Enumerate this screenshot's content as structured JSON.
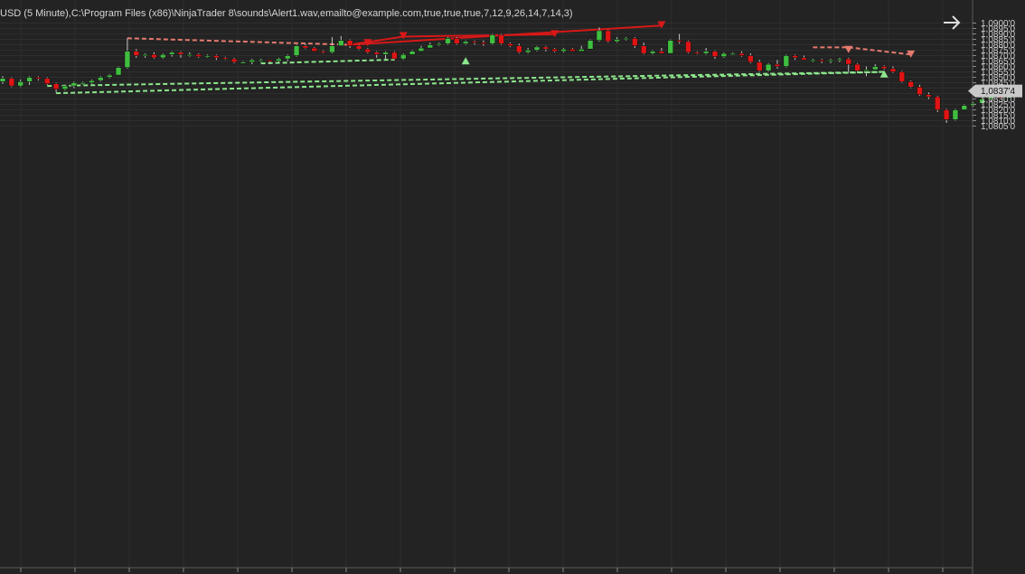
{
  "header": {
    "text": "USD (5 Minute),C:\\Program Files (x86)\\NinjaTrader 8\\sounds\\Alert1.wav,emailto@example.com,true,true,true,7,12,9,26,14,7,14,3)"
  },
  "colors": {
    "background": "#232323",
    "grid": "#2e2e2e",
    "up": "#3fbf3f",
    "down": "#e01414",
    "wick": "#c8c8c8",
    "bull_line": "#8ce68c",
    "bear_line_dashed": "#e57a6e",
    "bear_line_solid": "#d81818",
    "price_tag": "#c9c9c9"
  },
  "icons": {
    "nav": "arrow-right-icon"
  },
  "chart_data": {
    "type": "candlestick",
    "y_axis": {
      "range": [
        1.08015,
        1.0905
      ],
      "ticks": [
        "1,0900'0",
        "1,0895'0",
        "1,0890'0",
        "1,0885'0",
        "1,0880'0",
        "1,0875'0",
        "1,0870'0",
        "1,0865'0",
        "1,0860'0",
        "1,0855'0",
        "1,0850'0",
        "1,0845'0",
        "1,0840'0",
        "1,0835'0",
        "1,0830'0",
        "1,0825'0",
        "1,0820'0",
        "1,0815'0",
        "1,0810'0",
        "1,0805'0"
      ],
      "tick_values": [
        1.09,
        1.0895,
        1.089,
        1.0885,
        1.088,
        1.0875,
        1.087,
        1.0865,
        1.086,
        1.0855,
        1.085,
        1.0845,
        1.084,
        1.0835,
        1.083,
        1.0825,
        1.082,
        1.0815,
        1.081,
        1.0805
      ]
    },
    "current_price": {
      "label": "1,0837'4",
      "value": 1.08374
    },
    "candles": [
      [
        1.0846,
        1.0849,
        1.0844,
        1.0851
      ],
      [
        1.0849,
        1.0842,
        1.0841,
        1.085
      ],
      [
        1.0842,
        1.0846,
        1.0841,
        1.0848
      ],
      [
        1.0846,
        1.085,
        1.0843,
        1.0851
      ],
      [
        1.085,
        1.0849,
        1.0847,
        1.0851
      ],
      [
        1.0849,
        1.0844,
        1.0843,
        1.085
      ],
      [
        1.0844,
        1.0839,
        1.0836,
        1.0845
      ],
      [
        1.0839,
        1.0842,
        1.0838,
        1.0843
      ],
      [
        1.0842,
        1.0845,
        1.084,
        1.0846
      ],
      [
        1.0845,
        1.0845,
        1.0843,
        1.0846
      ],
      [
        1.0845,
        1.0847,
        1.0844,
        1.0848
      ],
      [
        1.0847,
        1.085,
        1.0846,
        1.0851
      ],
      [
        1.085,
        1.0852,
        1.0849,
        1.0853
      ],
      [
        1.0852,
        1.0859,
        1.0852,
        1.086
      ],
      [
        1.0859,
        1.0874,
        1.0858,
        1.0886
      ],
      [
        1.0874,
        1.087,
        1.0868,
        1.0876
      ],
      [
        1.087,
        1.0871,
        1.0868,
        1.0872
      ],
      [
        1.0871,
        1.0868,
        1.0867,
        1.0873
      ],
      [
        1.0868,
        1.0871,
        1.0867,
        1.0872
      ],
      [
        1.0871,
        1.0873,
        1.0869,
        1.0874
      ],
      [
        1.0873,
        1.0871,
        1.0868,
        1.0874
      ],
      [
        1.0871,
        1.0871,
        1.0869,
        1.0873
      ],
      [
        1.0871,
        1.0869,
        1.0868,
        1.0872
      ],
      [
        1.0869,
        1.087,
        1.0868,
        1.0871
      ],
      [
        1.087,
        1.0868,
        1.0866,
        1.0871
      ],
      [
        1.0868,
        1.0867,
        1.0866,
        1.0869
      ],
      [
        1.0867,
        1.0864,
        1.0863,
        1.0868
      ],
      [
        1.0864,
        1.0864,
        1.0863,
        1.0865
      ],
      [
        1.0864,
        1.0866,
        1.0862,
        1.0867
      ],
      [
        1.0866,
        1.0866,
        1.0864,
        1.0867
      ],
      [
        1.0866,
        1.0865,
        1.0863,
        1.0866
      ],
      [
        1.0865,
        1.0867,
        1.0864,
        1.0868
      ],
      [
        1.0867,
        1.087,
        1.0865,
        1.0871
      ],
      [
        1.087,
        1.0879,
        1.0869,
        1.088
      ],
      [
        1.0879,
        1.0877,
        1.0876,
        1.0881
      ],
      [
        1.0877,
        1.0874,
        1.0874,
        1.0878
      ],
      [
        1.0874,
        1.0873,
        1.0872,
        1.0875
      ],
      [
        1.0873,
        1.0879,
        1.0872,
        1.0887
      ],
      [
        1.0879,
        1.0884,
        1.0879,
        1.0888
      ],
      [
        1.0884,
        1.0879,
        1.0877,
        1.0885
      ],
      [
        1.0879,
        1.0876,
        1.0875,
        1.088
      ],
      [
        1.0876,
        1.0873,
        1.0872,
        1.0877
      ],
      [
        1.0873,
        1.0871,
        1.0868,
        1.0874
      ],
      [
        1.0871,
        1.0873,
        1.0867,
        1.0874
      ],
      [
        1.0873,
        1.0867,
        1.0866,
        1.0874
      ],
      [
        1.0867,
        1.0871,
        1.0866,
        1.0872
      ],
      [
        1.0871,
        1.0874,
        1.0871,
        1.0875
      ],
      [
        1.0874,
        1.0877,
        1.0874,
        1.0879
      ],
      [
        1.0877,
        1.088,
        1.0877,
        1.0882
      ],
      [
        1.088,
        1.0881,
        1.0879,
        1.0882
      ],
      [
        1.0881,
        1.0886,
        1.088,
        1.0887
      ],
      [
        1.0886,
        1.0881,
        1.088,
        1.0887
      ],
      [
        1.0881,
        1.0883,
        1.088,
        1.0884
      ],
      [
        1.0883,
        1.0882,
        1.088,
        1.0884
      ],
      [
        1.0882,
        1.0881,
        1.0879,
        1.0884
      ],
      [
        1.0881,
        1.0889,
        1.088,
        1.089
      ],
      [
        1.0889,
        1.0881,
        1.088,
        1.089
      ],
      [
        1.0881,
        1.0879,
        1.0878,
        1.0882
      ],
      [
        1.0879,
        1.0873,
        1.0872,
        1.0881
      ],
      [
        1.0873,
        1.0875,
        1.0872,
        1.0877
      ],
      [
        1.0875,
        1.0878,
        1.0874,
        1.0879
      ],
      [
        1.0878,
        1.0876,
        1.0874,
        1.0879
      ],
      [
        1.0876,
        1.0874,
        1.0873,
        1.0877
      ],
      [
        1.0874,
        1.0876,
        1.0873,
        1.0877
      ],
      [
        1.0876,
        1.0874,
        1.0874,
        1.0877
      ],
      [
        1.0874,
        1.0876,
        1.0874,
        1.0879
      ],
      [
        1.0876,
        1.0884,
        1.0876,
        1.0885
      ],
      [
        1.0884,
        1.0893,
        1.0883,
        1.0896
      ],
      [
        1.0893,
        1.0883,
        1.0882,
        1.0894
      ],
      [
        1.0883,
        1.0885,
        1.0882,
        1.0887
      ],
      [
        1.0885,
        1.0886,
        1.0884,
        1.0887
      ],
      [
        1.0886,
        1.0879,
        1.0877,
        1.0887
      ],
      [
        1.0879,
        1.0872,
        1.0871,
        1.0882
      ],
      [
        1.0872,
        1.0874,
        1.0871,
        1.0875
      ],
      [
        1.0874,
        1.0872,
        1.0872,
        1.0877
      ],
      [
        1.0872,
        1.0884,
        1.0872,
        1.0885
      ],
      [
        1.0884,
        1.0883,
        1.0881,
        1.089
      ],
      [
        1.0883,
        1.0873,
        1.0872,
        1.0884
      ],
      [
        1.0873,
        1.0872,
        1.0871,
        1.0874
      ],
      [
        1.0872,
        1.0874,
        1.0871,
        1.0877
      ],
      [
        1.0874,
        1.0869,
        1.0867,
        1.0875
      ],
      [
        1.0869,
        1.0872,
        1.0868,
        1.0873
      ],
      [
        1.0872,
        1.0872,
        1.0871,
        1.0873
      ],
      [
        1.0872,
        1.087,
        1.0869,
        1.0874
      ],
      [
        1.087,
        1.0864,
        1.0863,
        1.0872
      ],
      [
        1.0864,
        1.0856,
        1.0855,
        1.0866
      ],
      [
        1.0856,
        1.0862,
        1.0855,
        1.0863
      ],
      [
        1.0862,
        1.086,
        1.0858,
        1.0866
      ],
      [
        1.086,
        1.087,
        1.0859,
        1.0871
      ],
      [
        1.087,
        1.0868,
        1.0866,
        1.0871
      ],
      [
        1.0868,
        1.0866,
        1.0866,
        1.087
      ],
      [
        1.0866,
        1.0866,
        1.0864,
        1.0867
      ],
      [
        1.0866,
        1.0865,
        1.0863,
        1.0867
      ],
      [
        1.0865,
        1.0866,
        1.0863,
        1.0867
      ],
      [
        1.0866,
        1.0867,
        1.0864,
        1.0868
      ],
      [
        1.0867,
        1.0862,
        1.0855,
        1.0868
      ],
      [
        1.0862,
        1.0856,
        1.0855,
        1.0863
      ],
      [
        1.0856,
        1.0857,
        1.0851,
        1.086
      ],
      [
        1.0857,
        1.086,
        1.0857,
        1.0862
      ],
      [
        1.086,
        1.0858,
        1.0857,
        1.0861
      ],
      [
        1.0858,
        1.0855,
        1.0854,
        1.086
      ],
      [
        1.0855,
        1.0846,
        1.0845,
        1.0856
      ],
      [
        1.0846,
        1.0841,
        1.084,
        1.0847
      ],
      [
        1.0841,
        1.0834,
        1.0833,
        1.0843
      ],
      [
        1.0834,
        1.0832,
        1.083,
        1.0836
      ],
      [
        1.0832,
        1.082,
        1.0818,
        1.0833
      ],
      [
        1.082,
        1.0811,
        1.0808,
        1.0821
      ],
      [
        1.0811,
        1.082,
        1.081,
        1.0821
      ],
      [
        1.082,
        1.0824,
        1.082,
        1.0825
      ],
      [
        1.0824,
        1.0826,
        1.0823,
        1.0827
      ],
      [
        1.0826,
        1.083,
        1.0825,
        1.0831
      ],
      [
        1.083,
        1.0833,
        1.0828,
        1.0834
      ],
      [
        1.0833,
        1.0831,
        1.083,
        1.0834
      ],
      [
        1.0831,
        1.0838,
        1.0831,
        1.0839
      ]
    ],
    "bull_trendlines": [
      {
        "from": [
          5,
          1.0842
        ],
        "to": [
          99,
          1.0855
        ]
      },
      {
        "from": [
          6,
          1.08353
        ],
        "to": [
          99,
          1.0855
        ]
      },
      {
        "from": [
          29,
          1.08628
        ],
        "to": [
          44,
          1.08663
        ]
      }
    ],
    "bear_trendlines_dashed": [
      {
        "from": [
          14,
          1.0886
        ],
        "to": [
          39,
          1.088
        ]
      },
      {
        "from": [
          91,
          1.08776
        ],
        "to": [
          95,
          1.08776
        ]
      },
      {
        "from": [
          95,
          1.08776
        ],
        "to": [
          102,
          1.0871
        ]
      }
    ],
    "bear_trendlines_solid": [
      {
        "from": [
          39,
          1.088
        ],
        "to": [
          45,
          1.08875
        ]
      },
      {
        "from": [
          45,
          1.08875
        ],
        "to": [
          62,
          1.08896
        ]
      },
      {
        "from": [
          39,
          1.088
        ],
        "to": [
          74,
          1.08977
        ]
      }
    ],
    "signals_up": [
      {
        "bar": 52,
        "price": 1.0866
      },
      {
        "bar": 99,
        "price": 1.0854
      }
    ],
    "signals_down": [
      {
        "bar": 41,
        "price": 1.0881
      },
      {
        "bar": 45,
        "price": 1.08875
      },
      {
        "bar": 62,
        "price": 1.08893
      },
      {
        "bar": 74,
        "price": 1.08975
      },
      {
        "bar": 95,
        "price": 1.08748
      },
      {
        "bar": 102,
        "price": 1.08705
      }
    ]
  }
}
